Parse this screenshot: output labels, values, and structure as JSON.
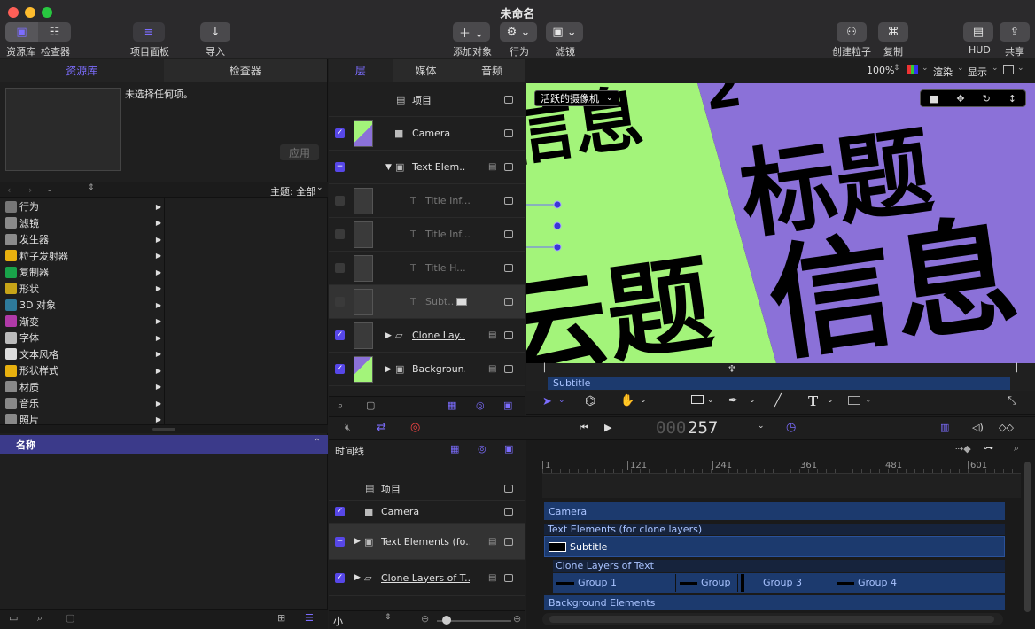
{
  "window": {
    "title": "未命名"
  },
  "toolbar": {
    "library": "资源库",
    "inspector": "检查器",
    "project_panel": "项目面板",
    "import": "导入",
    "add_object": "添加对象",
    "behaviors": "行为",
    "filters": "滤镜",
    "create_particles": "创建粒子",
    "replicate": "复制",
    "hud": "HUD",
    "share": "共享"
  },
  "left_panel": {
    "tabs": [
      "资源库",
      "检查器"
    ],
    "no_selection": "未选择任何项。",
    "apply": "应用",
    "nav_value": "-",
    "theme_label": "主题: 全部",
    "categories": [
      "行为",
      "滤镜",
      "发生器",
      "粒子发射器",
      "复制器",
      "形状",
      "3D 对象",
      "渐变",
      "字体",
      "文本风格",
      "形状样式",
      "材质",
      "音乐",
      "照片"
    ],
    "name_header": "名称"
  },
  "layers_panel": {
    "tabs": [
      "层",
      "媒体",
      "音频"
    ],
    "project": "项目",
    "rows": [
      "Camera",
      "Text Elem...",
      "Title Inf...",
      "Title Inf...",
      "Title H...",
      "Subt...",
      "Clone Lay...",
      "Backgroun..."
    ]
  },
  "canvas": {
    "zoom": "100%",
    "render": "渲染",
    "display": "显示",
    "active_camera": "活跃的摄像机",
    "overlay_texts": [
      "信息",
      "2",
      "标题",
      "云题",
      "信息"
    ],
    "subtitle_bar": "Subtitle",
    "colors": {
      "green": "#a3f47a",
      "purple": "#8b71d8"
    }
  },
  "transport": {
    "timecode_dim": "000",
    "timecode": "257"
  },
  "timeline": {
    "label": "时间线",
    "project": "项目",
    "camera": "Camera",
    "rows": [
      "Text Elements (fo...",
      "Clone Layers of T..."
    ],
    "ruler": [
      "1",
      "121",
      "241",
      "361",
      "481",
      "601"
    ],
    "tracks": {
      "camera": "Camera",
      "text_elements": "Text Elements (for clone layers)",
      "subtitle": "Subtitle",
      "clone_layers": "Clone Layers of Text",
      "groups": [
        "Group 1",
        "Group",
        "Group 3",
        "Group 4"
      ],
      "background": "Background Elements"
    },
    "size_label": "小"
  }
}
